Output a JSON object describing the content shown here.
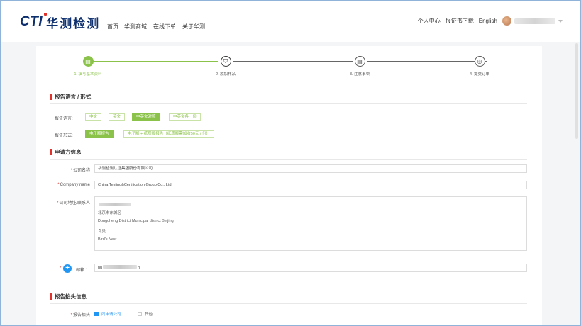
{
  "header": {
    "logo_brand": "CTI",
    "logo_cn": "华测检测",
    "nav": [
      "首页",
      "华测商城",
      "在线下单",
      "关于华测"
    ],
    "active_nav": "在线下单",
    "right_links": [
      "个人中心",
      "报证书下载",
      "English"
    ],
    "avatar_icon": "user-avatar"
  },
  "steps": [
    {
      "label": "1. 填写基本资料",
      "icon": "form-icon",
      "glyph": "▤"
    },
    {
      "label": "2. 添加样品",
      "icon": "sample-icon",
      "glyph": "⛉"
    },
    {
      "label": "3. 注意事项",
      "icon": "notice-icon",
      "glyph": "▤"
    },
    {
      "label": "4. 提交订单",
      "icon": "submit-icon",
      "glyph": "◎"
    }
  ],
  "report_format": {
    "title": "报告语言 / 形式",
    "language_label": "报告语言:",
    "language_options": [
      "中文",
      "英文",
      "中英文对照",
      "中英文各一份"
    ],
    "language_selected": "中英文对照",
    "form_label": "报告形式:",
    "form_options": [
      "电子版报告",
      "电子版 + 纸质版报告（纸质版需加收50元 / 份）"
    ],
    "form_selected": "电子版报告"
  },
  "applicant": {
    "title": "申请方信息",
    "company_label": "公司名称",
    "company_value": "华测检测认证集团股份有限公司",
    "company_en_label": "Company name",
    "company_en_value": "China Testing&Certification Group Co., Ltd.",
    "address_label": "公司地址/联系人",
    "address_lines": [
      "北京市东城区",
      "Dongcheng District Municipal district Beijing",
      "鸟巢",
      "Bird's Nest"
    ],
    "email_label": "邮箱 1",
    "email_value_start": "hu",
    "email_value_end": "n"
  },
  "report_header": {
    "title": "报告抬头信息",
    "label": "报告抬头",
    "options": [
      "同申请公司",
      "其他"
    ],
    "checked": "同申请公司"
  },
  "colors": {
    "accent_green": "#8bc34a",
    "brand_navy": "#0d2f6e",
    "highlight_red": "#e0312a",
    "link_blue": "#2196f3"
  }
}
